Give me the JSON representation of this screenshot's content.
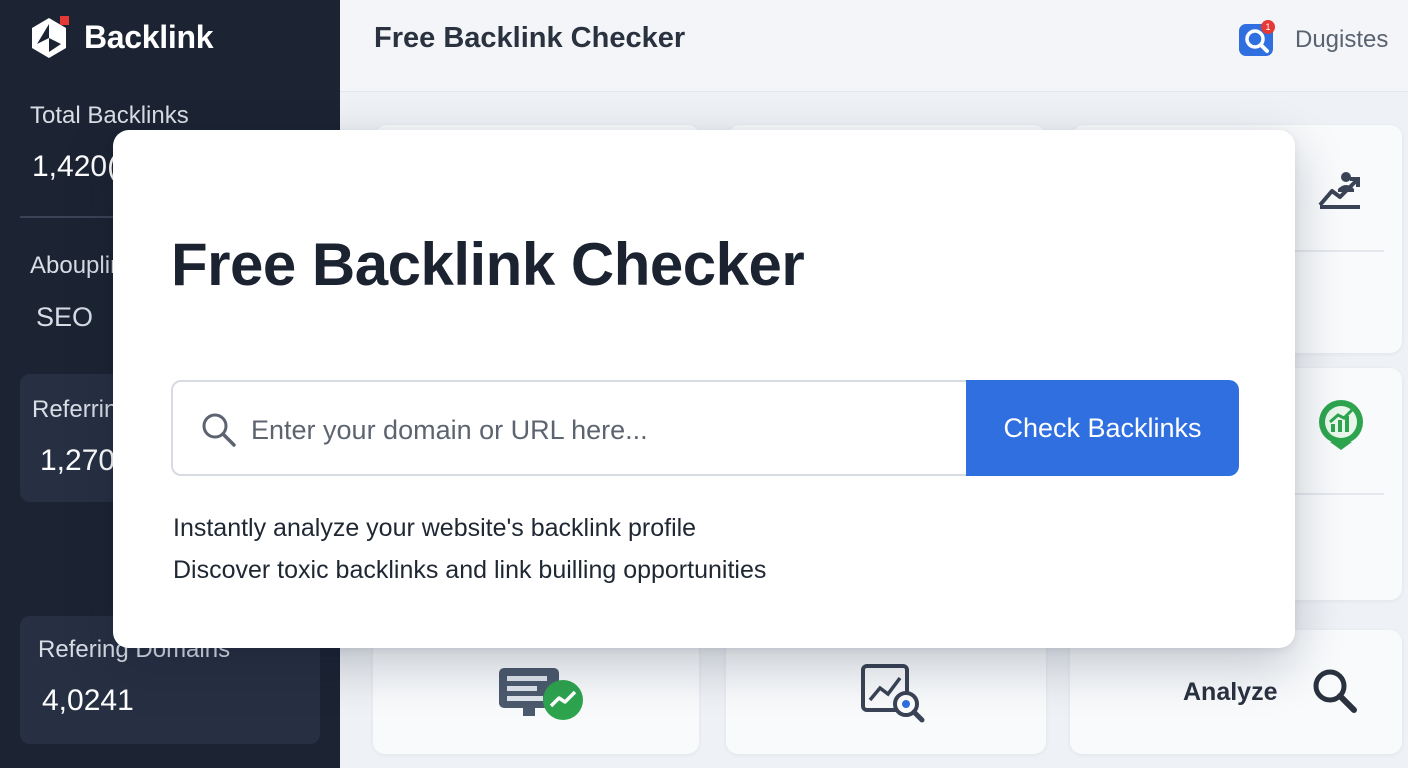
{
  "sidebar": {
    "brand": "Backlink",
    "stats": [
      {
        "label": "Total Backlinks",
        "value": "1,420("
      },
      {
        "label": "Abouplin",
        "value": "SEO"
      },
      {
        "label": "Referrin",
        "value": "1,270"
      },
      {
        "label": "Refering Domains",
        "value": "4,0241"
      }
    ]
  },
  "topbar": {
    "title": "Free Backlink Checker",
    "notification_count": "1",
    "user": "Dugistes"
  },
  "modal": {
    "title": "Free Backlink Checker",
    "search_placeholder": "Enter your domain or URL here...",
    "button_label": "Check Backlinks",
    "descriptions": [
      "Instantly analyze your website's backlink profile",
      "Discover toxic backlinks and link builling opportunities"
    ]
  },
  "cards": {
    "analyze_label": "Analyze"
  },
  "icons": {
    "brand": "brand-logo-icon",
    "notify": "search-notification-icon",
    "search": "search-icon",
    "growth": "growth-chart-icon",
    "award": "award-chart-icon",
    "monitor": "monitor-growth-icon",
    "report": "report-magnifier-icon",
    "analyze": "magnifier-icon"
  },
  "colors": {
    "sidebar": "#1c2433",
    "accent": "#2f6fe0",
    "success": "#2ea44f",
    "alert": "#e53935"
  }
}
